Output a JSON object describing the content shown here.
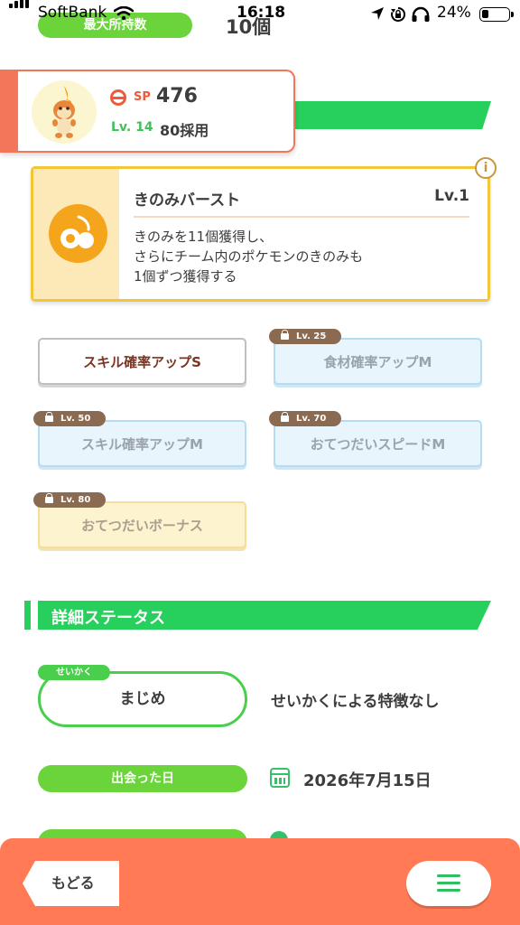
{
  "status_bar": {
    "carrier": "SoftBank",
    "time": "16:18",
    "battery": "24%"
  },
  "top_row": {
    "label": "最大所持数",
    "value": "10個"
  },
  "pokemon_card": {
    "sp_label": "SP",
    "sp_value": "476",
    "level": "Lv. 14",
    "adoption": "80採用"
  },
  "main_skill": {
    "name": "きのみバースト",
    "level": "Lv.1",
    "description": [
      "きのみを11個獲得し、",
      "さらにチーム内のポケモンのきのみも",
      "1個ずつ獲得する"
    ],
    "info_glyph": "i"
  },
  "sub_skills": [
    {
      "label": "スキル確率アップS",
      "lock_level": ""
    },
    {
      "label": "食材確率アップM",
      "lock_level": "Lv. 25"
    },
    {
      "label": "スキル確率アップM",
      "lock_level": "Lv. 50"
    },
    {
      "label": "おてつだいスピードM",
      "lock_level": "Lv. 70"
    },
    {
      "label": "おてつだいボーナス",
      "lock_level": "Lv. 80"
    }
  ],
  "details": {
    "section_title": "詳細ステータス",
    "nature_tag": "せいかく",
    "nature": "まじめ",
    "nature_effect": "せいかくによる特徴なし",
    "met_label": "出会った日",
    "met_date": "2026年7月15日"
  },
  "bottom_bar": {
    "back_label": "もどる"
  },
  "colors": {
    "accent_green": "#27cf5c",
    "pill_green": "#6ad43a",
    "bottom_bar": "#ff7a55",
    "skill_gold": "#f3c63a"
  }
}
